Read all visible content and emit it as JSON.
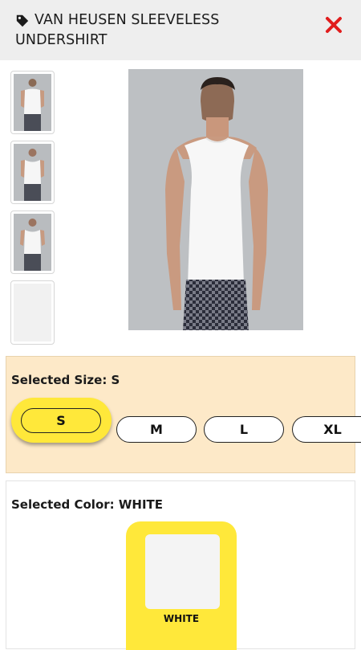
{
  "header": {
    "title": "VAN HEUSEN SLEEVELESS UNDERSHIRT",
    "tag_icon": "tag-icon",
    "close_icon": "close-icon",
    "close_color": "#e11d1d"
  },
  "gallery": {
    "thumbnails": [
      {
        "name": "back view"
      },
      {
        "name": "front view"
      },
      {
        "name": "front view alt"
      },
      {
        "name": "fabric swatch"
      }
    ]
  },
  "size": {
    "label": "Selected Size: S",
    "options": [
      "S",
      "M",
      "L",
      "XL"
    ],
    "selected": "S",
    "accent": "#ffe83a",
    "panel_bg": "#fde9c8"
  },
  "color": {
    "label": "Selected Color: WHITE",
    "options": [
      {
        "name": "WHITE"
      }
    ],
    "selected": "WHITE"
  }
}
